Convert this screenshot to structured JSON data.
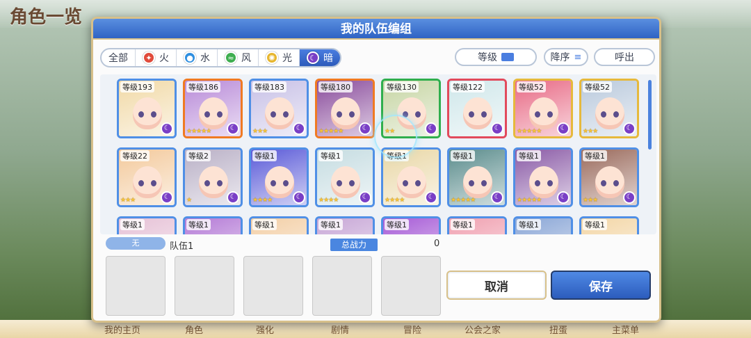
{
  "background": {
    "title": "角色一览",
    "bottom_nav": [
      "我的主页",
      "角色",
      "强化",
      "剧情",
      "冒险",
      "公会之家",
      "扭蛋",
      "主菜单"
    ]
  },
  "modal": {
    "title": "我的队伍编组",
    "filters": [
      {
        "label": "全部",
        "icon": "",
        "color": ""
      },
      {
        "label": "火",
        "icon": "fire-element-icon",
        "color": "#e14b3b"
      },
      {
        "label": "水",
        "icon": "water-element-icon",
        "color": "#2f8fe0"
      },
      {
        "label": "风",
        "icon": "wind-element-icon",
        "color": "#3fae4f"
      },
      {
        "label": "光",
        "icon": "light-element-icon",
        "color": "#e7b62e"
      },
      {
        "label": "暗",
        "icon": "dark-element-icon",
        "color": "#7a3fc6"
      }
    ],
    "active_filter": "暗",
    "sort": {
      "level_label": "等级",
      "order_label": "降序",
      "call_label": "呼出"
    },
    "characters": [
      {
        "level": "等级193",
        "stars": 0,
        "frame": "#4f8fe6",
        "bg": "#f1d9a6"
      },
      {
        "level": "等级186",
        "stars": 5,
        "frame": "#f07a22",
        "bg": "#b88ad8"
      },
      {
        "level": "等级183",
        "stars": 3,
        "frame": "#4f8fe6",
        "bg": "#c7c0e6"
      },
      {
        "level": "等级180",
        "stars": 5,
        "frame": "#f07a22",
        "bg": "#8a4c9c"
      },
      {
        "level": "等级130",
        "stars": 2,
        "frame": "#2fae4d",
        "bg": "#c6d5a3"
      },
      {
        "level": "等级122",
        "stars": 0,
        "frame": "#e24a5c",
        "bg": "#cfe7ea"
      },
      {
        "level": "等级52",
        "stars": 5,
        "frame": "#e6b93c",
        "bg": "#e86a85"
      },
      {
        "level": "等级52",
        "stars": 3,
        "frame": "#e6b93c",
        "bg": "#b9c9dc"
      },
      {
        "level": "等级22",
        "stars": 3,
        "frame": "#4f8fe6",
        "bg": "#f3c99b"
      },
      {
        "level": "等级2",
        "stars": 1,
        "frame": "#4f8fe6",
        "bg": "#b9b0c6"
      },
      {
        "level": "等级1",
        "stars": 4,
        "frame": "#4f8fe6",
        "bg": "#5a5ad8"
      },
      {
        "level": "等级1",
        "stars": 4,
        "frame": "#4f8fe6",
        "bg": "#c5dce1"
      },
      {
        "level": "等级1",
        "stars": 4,
        "frame": "#4f8fe6",
        "bg": "#e9d7a6"
      },
      {
        "level": "等级1",
        "stars": 5,
        "frame": "#4f8fe6",
        "bg": "#5a8c8c"
      },
      {
        "level": "等级1",
        "stars": 5,
        "frame": "#4f8fe6",
        "bg": "#8a5aa6"
      },
      {
        "level": "等级1",
        "stars": 3,
        "frame": "#4f8fe6",
        "bg": "#9a6a5c"
      },
      {
        "level": "等级1",
        "stars": 0,
        "frame": "#4f8fe6",
        "bg": "#e6c1d6"
      },
      {
        "level": "等级1",
        "stars": 0,
        "frame": "#4f8fe6",
        "bg": "#b47ad6"
      },
      {
        "level": "等级1",
        "stars": 0,
        "frame": "#4f8fe6",
        "bg": "#f3cfa6"
      },
      {
        "level": "等级1",
        "stars": 0,
        "frame": "#4f8fe6",
        "bg": "#c7a6d6"
      },
      {
        "level": "等级1",
        "stars": 0,
        "frame": "#4f8fe6",
        "bg": "#a65ad6"
      },
      {
        "level": "等级1",
        "stars": 0,
        "frame": "#4f8fe6",
        "bg": "#f0a0b0"
      },
      {
        "level": "等级1",
        "stars": 0,
        "frame": "#4f8fe6",
        "bg": "#8aa6d6"
      },
      {
        "level": "等级1",
        "stars": 0,
        "frame": "#4f8fe6",
        "bg": "#f3d6a6"
      }
    ],
    "team": {
      "tag": "无",
      "name": "队伍1",
      "power_label": "总战力",
      "power_value": "0",
      "slot_count": 5
    },
    "buttons": {
      "cancel": "取消",
      "save": "保存"
    }
  }
}
